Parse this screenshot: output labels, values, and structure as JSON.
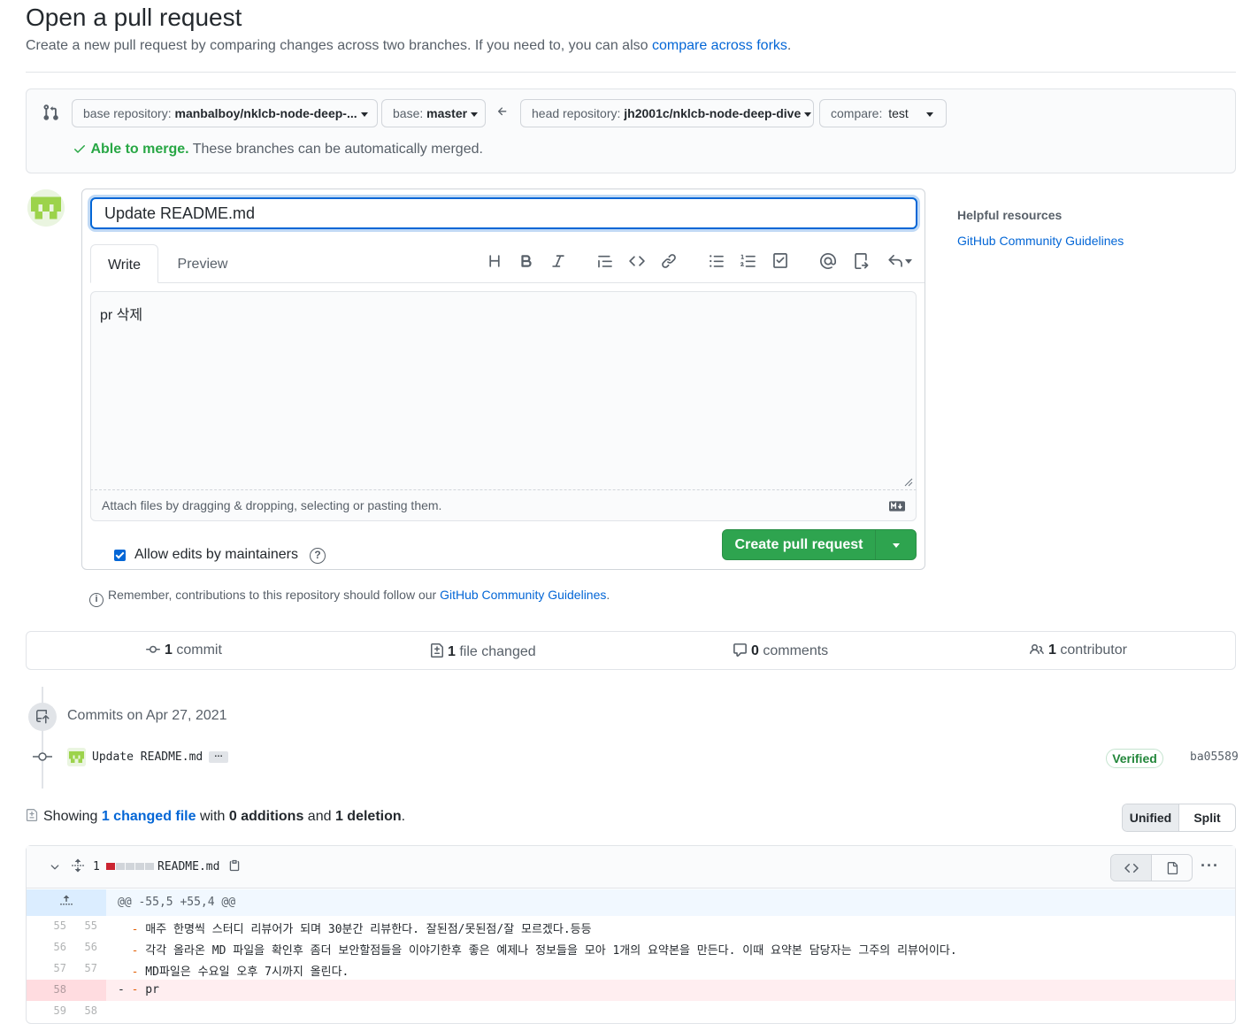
{
  "header": {
    "title": "Open a pull request",
    "subtitle": "Create a new pull request by comparing changes across two branches. If you need to, you can also",
    "subtitle_link": "compare across forks",
    "subtitle_end": "."
  },
  "compare": {
    "base_repo_label": "base repository:",
    "base_repo_value": "manbalboy/nklcb-node-deep-...",
    "base_label": "base:",
    "base_value": "master",
    "head_repo_label": "head repository:",
    "head_repo_value": "jh2001c/nklcb-node-deep-dive",
    "compare_label": "compare:",
    "compare_value": "test",
    "merge_ok": "Able to merge.",
    "merge_msg": "These branches can be automatically merged."
  },
  "form": {
    "title_value": "Update README.md",
    "tab_write": "Write",
    "tab_preview": "Preview",
    "body_value": "pr 삭제",
    "attach_hint": "Attach files by dragging & dropping, selecting or pasting them.",
    "allow_edits": "Allow edits by maintainers",
    "allow_edits_checked": true,
    "create_button": "Create pull request"
  },
  "toolbar_icons": [
    "heading-icon",
    "bold-icon",
    "italic-icon",
    "quote-icon",
    "code-icon",
    "link-icon",
    "bullet-list-icon",
    "numbered-list-icon",
    "task-list-icon",
    "mention-icon",
    "cross-reference-icon",
    "reply-icon"
  ],
  "remember": {
    "text": "Remember, contributions to this repository should follow our",
    "link": "GitHub Community Guidelines",
    "end": "."
  },
  "sidebar": {
    "title": "Helpful resources",
    "link": "GitHub Community Guidelines"
  },
  "summary": {
    "commits_count": "1",
    "commits_label": "commit",
    "files_count": "1",
    "files_label": "file changed",
    "comments_count": "0",
    "comments_label": "comments",
    "contributors_count": "1",
    "contributors_label": "contributor"
  },
  "timeline": {
    "date_label": "Commits on Apr 27, 2021",
    "commit_message": "Update README.md",
    "ellipsis": "…",
    "verified": "Verified",
    "sha": "ba05589"
  },
  "showing": {
    "prefix": "Showing",
    "changed_link": "1 changed file",
    "with": "with",
    "additions": "0 additions",
    "and": "and",
    "deletions": "1 deletion",
    "end": ".",
    "unified": "Unified",
    "split": "Split"
  },
  "file": {
    "changes": "1",
    "name": "README.md",
    "hunk_header": "@@ -55,5 +55,4 @@",
    "lines": [
      {
        "old": "55",
        "new": "55",
        "sign": " ",
        "bullet": "-",
        "text": " 매주 한명씩 스터디 리뷰어가 되며 30분간 리뷰한다. 잘된점/못된점/잘 모르겠다.등등",
        "type": "ctx"
      },
      {
        "old": "56",
        "new": "56",
        "sign": " ",
        "bullet": "-",
        "text": " 각각 올라온 MD 파일을 확인후 좀더 보안할점들을 이야기한후 좋은 예제나 정보들을 모아 1개의 요약본을 만든다. 이때 요약본 담당자는 그주의 리뷰어이다.",
        "type": "ctx"
      },
      {
        "old": "57",
        "new": "57",
        "sign": " ",
        "bullet": "-",
        "text": " MD파일은 수요일 오후 7시까지 올린다.",
        "type": "ctx"
      },
      {
        "old": "58",
        "new": "",
        "sign": "-",
        "bullet": "-",
        "text": " pr",
        "type": "del"
      },
      {
        "old": "59",
        "new": "58",
        "sign": " ",
        "bullet": "",
        "text": "",
        "type": "ctx"
      }
    ]
  },
  "colors": {
    "accent": "#0366d6",
    "success": "#2ea44f",
    "deletion": "#cb2431"
  }
}
